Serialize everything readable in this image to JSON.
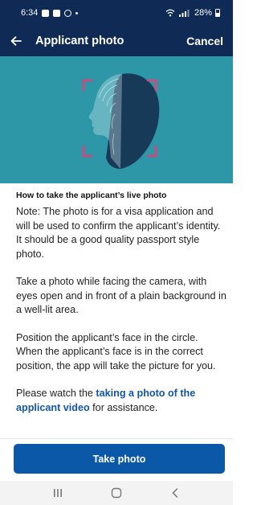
{
  "status_bar": {
    "time": "6:34",
    "battery": "28%",
    "signal_text": "சோ.ill"
  },
  "header": {
    "title": "Applicant photo",
    "cancel_label": "Cancel",
    "back_icon": "arrow-left-icon",
    "background": "#0f2a55"
  },
  "hero": {
    "background": "#2d97a8",
    "illustration": "face-scan-illustration"
  },
  "instructions": {
    "heading": "How to take the applicant’s live photo",
    "note": "Note: The photo is for a visa application and will be used to confirm the applicant’s identity. It should be a good quality passport style photo.",
    "step_facing": "Take a photo while facing the camera, with eyes open and in front of a plain background in a well-lit area.",
    "step_position": "Position the applicant’s face in the circle. When the applicant’s face is in the correct position, the app will take the picture for you.",
    "watch_prefix": "Please watch the ",
    "watch_link": "taking a photo of the applicant video",
    "watch_suffix": " for assistance."
  },
  "take_photo_button": {
    "label": "Take photo",
    "color": "#0b57a8"
  },
  "nav_bar": {
    "items": [
      "recent-apps-icon",
      "home-icon",
      "back-icon"
    ]
  }
}
